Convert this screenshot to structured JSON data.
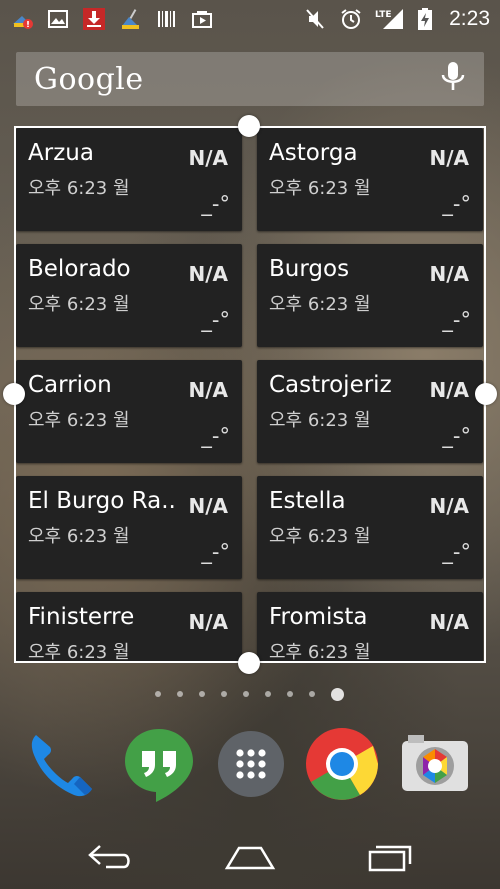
{
  "status_bar": {
    "time": "2:23",
    "network": "LTE",
    "left_icons": [
      "cleaner-alert-icon",
      "gallery-icon",
      "download-icon",
      "broom-icon",
      "barcode-icon",
      "store-icon"
    ],
    "right_icons": [
      "mute-icon",
      "alarm-icon",
      "signal-icon",
      "battery-charging-icon"
    ]
  },
  "search": {
    "logo": "Google",
    "mic_icon": "mic-icon"
  },
  "weather_widget": {
    "cards": [
      {
        "city": "Arzua",
        "status": "N/A",
        "time": "오후 6:23 월",
        "temp": "_-°"
      },
      {
        "city": "Astorga",
        "status": "N/A",
        "time": "오후 6:23 월",
        "temp": "_-°"
      },
      {
        "city": "Belorado",
        "status": "N/A",
        "time": "오후 6:23 월",
        "temp": "_-°"
      },
      {
        "city": "Burgos",
        "status": "N/A",
        "time": "오후 6:23 월",
        "temp": "_-°"
      },
      {
        "city": "Carrion",
        "status": "N/A",
        "time": "오후 6:23 월",
        "temp": "_-°"
      },
      {
        "city": "Castrojeriz",
        "status": "N/A",
        "time": "오후 6:23 월",
        "temp": "_-°"
      },
      {
        "city": "El Burgo Ra...",
        "status": "N/A",
        "time": "오후 6:23 월",
        "temp": "_-°"
      },
      {
        "city": "Estella",
        "status": "N/A",
        "time": "오후 6:23 월",
        "temp": "_-°"
      },
      {
        "city": "Finisterre",
        "status": "N/A",
        "time": "오후 6:23 월",
        "temp": ""
      },
      {
        "city": "Fromista",
        "status": "N/A",
        "time": "오후 6:23 월",
        "temp": ""
      }
    ]
  },
  "pager": {
    "page_count": 9,
    "active_index": 8
  },
  "dock": {
    "apps": [
      "phone-icon",
      "hangouts-icon",
      "app-drawer-icon",
      "chrome-icon",
      "camera-icon"
    ]
  },
  "navbar": {
    "buttons": [
      "back-icon",
      "home-icon",
      "recents-icon"
    ]
  },
  "colors": {
    "card_bg": "#222222",
    "frame": "#ffffff",
    "text": "#ffffff"
  }
}
